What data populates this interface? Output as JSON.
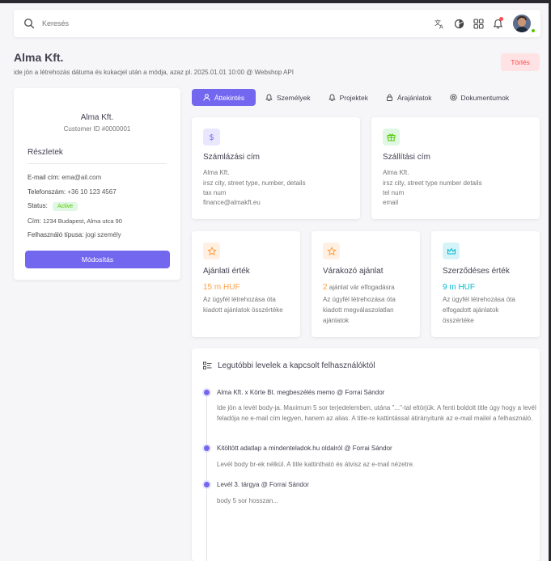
{
  "navbar": {
    "search_placeholder": "Keresés",
    "icons": [
      "search-icon",
      "translate-icon",
      "theme-icon",
      "grid-icon",
      "bell-icon"
    ]
  },
  "page": {
    "title": "Alma Kft.",
    "subtitle": "ide jön a létrehozás dátuma és kukacjel után a módja, azaz pl. 2025.01.01 10:00 @ Webshop API",
    "delete_label": "Törlés"
  },
  "profile": {
    "name": "Alma Kft.",
    "customer_id": "Customer ID #0000001",
    "details_title": "Részletek",
    "rows": [
      {
        "label": "E-mail cím:",
        "value": "ema@ail.com"
      },
      {
        "label": "Telefonszám:",
        "value": "+36 10 123 4567"
      },
      {
        "label": "Status:",
        "value": "Active"
      },
      {
        "label": "Cím:",
        "value": "1234 Budapest, Alma utca 90"
      },
      {
        "label": "Felhasználó típusa:",
        "value": "jogi személy"
      }
    ],
    "edit_label": "Módosítás"
  },
  "tabs": [
    {
      "label": "Áttekintés",
      "icon": "user-icon",
      "active": true
    },
    {
      "label": "Személyek",
      "icon": "bell-icon",
      "active": false
    },
    {
      "label": "Projektek",
      "icon": "bell-icon",
      "active": false
    },
    {
      "label": "Árajánlatok",
      "icon": "lock-icon",
      "active": false
    },
    {
      "label": "Dokumentumok",
      "icon": "map-pin-icon",
      "active": false
    }
  ],
  "billing": {
    "title": "Számlázási cím",
    "icon": "dollar-icon",
    "lines": [
      "Alma Kft.",
      "irsz city, street type, number, details",
      "tax num",
      "finance@almakft.eu"
    ]
  },
  "shipping": {
    "title": "Szállítási cím",
    "icon": "gift-icon",
    "lines": [
      "Alma Kft.",
      "irsz city, street type number details",
      "tel num",
      "email"
    ]
  },
  "stats": [
    {
      "title": "Ajánlati érték",
      "icon": "star-icon",
      "value": "15 m HUF",
      "value_suffix": "",
      "color": "#ff9f43",
      "desc": "Az ügyfél létrehozása óta kiadott ajánlatok összértéke"
    },
    {
      "title": "Várakozó ajánlat",
      "icon": "star-icon",
      "value": "2",
      "value_suffix": " ajánlat vár elfogadásra",
      "color": "#ff9f43",
      "desc": "Az ügyfél létrehozása óta kiadott megválaszolatlan ajánlatok"
    },
    {
      "title": "Szerződéses érték",
      "icon": "crown-icon",
      "value": "9 m HUF",
      "value_suffix": "",
      "color": "#00bad1",
      "desc": "Az ügyfél létrehozása óta elfogadott ajánlatok összértéke"
    }
  ],
  "emails": {
    "title": "Legutóbbi levelek a kapcsolt felhasználóktól",
    "items": [
      {
        "title": "Alma Kft. x Körte Bt. megbeszélés memo @ Forrai Sándor",
        "body": "Ide jön a levél body-ja. Maximum 5 sor terjedelemben, utána \"...\"-tal eltörjük. A fenti boldolt title úgy hogy a levél feladója ne e-mail cím legyen, hanem az alias. A title-re kattintással átirányitunk az e-mail mailel a felhasználó."
      },
      {
        "title": "Kitöltött adatlap a mindenteladok.hu oldalról @ Forrai Sándor",
        "body": "Levél body br-ek nélkül. A title kattintható és átvisz az e-mail nézetre."
      },
      {
        "title": "Levél 3. tárgya @ Forrai Sándor",
        "body": "body 5 sor hosszan..."
      }
    ]
  },
  "colors": {
    "primary": "#7367f0",
    "danger": "#ff4c51",
    "success": "#56ca00",
    "warning": "#ff9f43",
    "info": "#00bad1"
  }
}
